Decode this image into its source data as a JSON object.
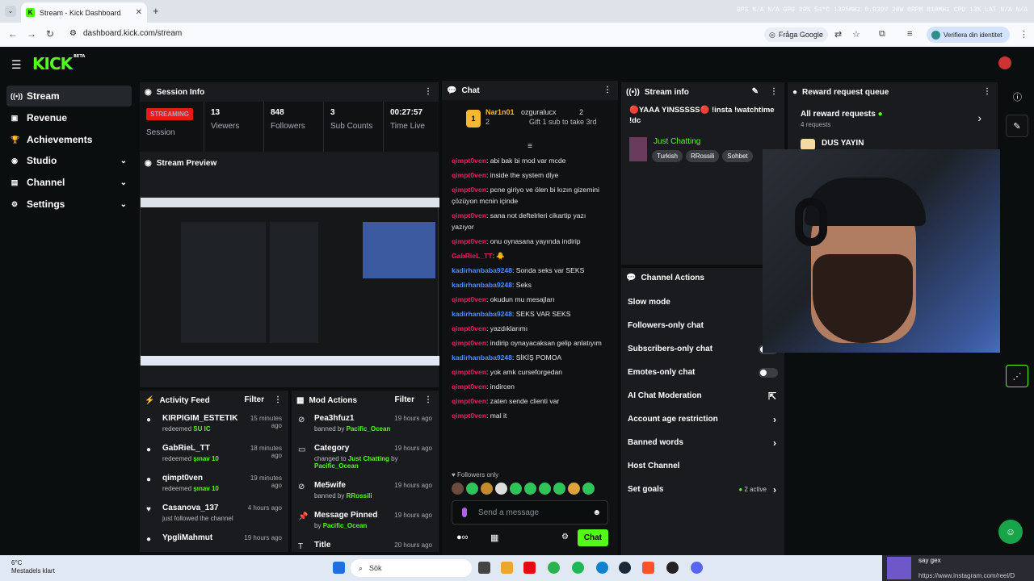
{
  "browser": {
    "tab_title": "Stream - Kick Dashboard",
    "url": "dashboard.kick.com/stream",
    "ask_google": "Fråga Google",
    "verify_identity": "Verifiera din identitet",
    "hud": "BPS N/A N/A   GPU 29% 54°C 1395MHz 0.930V 28W 0RPM 810MHz   CPU 13%   LAT N/A N/A"
  },
  "app": {
    "logo": "KICK",
    "logo_badge": "BETA",
    "accent": "#53fc18"
  },
  "sidebar": {
    "items": [
      {
        "label": "Stream",
        "icon": "broadcast-icon"
      },
      {
        "label": "Revenue",
        "icon": "wallet-icon"
      },
      {
        "label": "Achievements",
        "icon": "trophy-icon"
      },
      {
        "label": "Studio",
        "icon": "studio-icon"
      },
      {
        "label": "Channel",
        "icon": "user-icon"
      },
      {
        "label": "Settings",
        "icon": "gear-icon"
      }
    ]
  },
  "session": {
    "title": "Session Info",
    "status": "STREAMING",
    "session_label": "Session",
    "stats": [
      {
        "value": "13",
        "label": "Viewers"
      },
      {
        "value": "848",
        "label": "Followers"
      },
      {
        "value": "3",
        "label": "Sub Counts"
      },
      {
        "value": "00:27:57",
        "label": "Time Live"
      }
    ]
  },
  "preview": {
    "title": "Stream Preview"
  },
  "activity": {
    "title": "Activity Feed",
    "filter": "Filter",
    "items": [
      {
        "name": "KIRPIGIM_ESTETIK",
        "action": "redeemed",
        "reward": "SU IC",
        "time": "15 minutes ago"
      },
      {
        "name": "GabRieL_TT",
        "action": "redeemed",
        "reward": "şınav 10",
        "time": "18 minutes ago"
      },
      {
        "name": "qimpt0ven",
        "action": "redeemed",
        "reward": "şınav 10",
        "time": "19 minutes ago"
      },
      {
        "name": "Casanova_137",
        "action": "just followed the channel",
        "reward": "",
        "time": "4 hours ago"
      },
      {
        "name": "YpgliMahmut",
        "action": "",
        "reward": "",
        "time": "19 hours ago"
      }
    ]
  },
  "mod": {
    "title": "Mod Actions",
    "filter": "Filter",
    "items": [
      {
        "title": "Pea3hfuz1",
        "sub": "banned by",
        "by": "Pacific_Ocean",
        "time": "19 hours ago",
        "extra": ""
      },
      {
        "title": "Category",
        "sub": "changed to",
        "by": "Just Chatting",
        "time": "19 hours ago",
        "extra": "Pacific_Ocean"
      },
      {
        "title": "Me5wife",
        "sub": "banned by",
        "by": "RRossili",
        "time": "19 hours ago",
        "extra": ""
      },
      {
        "title": "Message Pinned",
        "sub": "by",
        "by": "Pacific_Ocean",
        "time": "19 hours ago",
        "extra": ""
      },
      {
        "title": "Title",
        "sub": "",
        "by": "",
        "time": "20 hours ago",
        "extra": ""
      }
    ]
  },
  "chat": {
    "title": "Chat",
    "leader1_name": "Nar1n01",
    "leader1_count": "2",
    "leader2_name": "ozguralucx",
    "leader2_count": "2",
    "leader2_sub": "Gift 1 sub to take 3rd",
    "messages": [
      {
        "user": "qimpt0ven",
        "color": "red",
        "text": "abi bak bi mod var mcde"
      },
      {
        "user": "qimpt0ven",
        "color": "red",
        "text": "inside the system diye"
      },
      {
        "user": "qimpt0ven",
        "color": "red",
        "text": "pcne giriyo ve ölen bi kızın gizemini çözüyon mcnin içinde"
      },
      {
        "user": "qimpt0ven",
        "color": "red",
        "text": "sana not deftelrleri cikartip yazı yazıyor"
      },
      {
        "user": "qimpt0ven",
        "color": "red",
        "text": "onu oynasana yayında indirip"
      },
      {
        "user": "GabRieL_TT",
        "color": "red",
        "text": "🐥"
      },
      {
        "user": "kadirhanbaba9248",
        "color": "blue",
        "text": "Sonda seks var SEKS"
      },
      {
        "user": "kadirhanbaba9248",
        "color": "blue",
        "text": "Seks"
      },
      {
        "user": "qimpt0ven",
        "color": "red",
        "text": "okudun mu mesajları"
      },
      {
        "user": "kadirhanbaba9248",
        "color": "blue",
        "text": "SEKS VAR SEKS"
      },
      {
        "user": "qimpt0ven",
        "color": "red",
        "text": "yazdıklarımı"
      },
      {
        "user": "qimpt0ven",
        "color": "red",
        "text": "indirip oynayacaksan gelip anlatıyım"
      },
      {
        "user": "kadirhanbaba9248",
        "color": "blue",
        "text": "SİKİŞ POMOA"
      },
      {
        "user": "qimpt0ven",
        "color": "red",
        "text": "yok amk curseforgedan"
      },
      {
        "user": "qimpt0ven",
        "color": "red",
        "text": "indircen"
      },
      {
        "user": "qimpt0ven",
        "color": "red",
        "text": "zaten sende clienti var"
      },
      {
        "user": "qimpt0ven",
        "color": "red",
        "text": "mal it"
      }
    ],
    "followers_only": "Followers only",
    "placeholder": "Send a message",
    "send": "Chat"
  },
  "stream_info": {
    "title": "Stream info",
    "stream_title": "🔴YAAA YINSSSSS🔴 !insta !watchtime !dc",
    "category": "Just Chatting",
    "tags": [
      "Turkish",
      "RRossili",
      "Sohbet"
    ]
  },
  "reward_queue": {
    "title": "Reward request queue",
    "all": "All reward requests",
    "count": "4 requests",
    "first": "DUS YAYIN"
  },
  "channel_actions": {
    "title": "Channel Actions",
    "items": [
      {
        "label": "Slow mode",
        "kind": "none"
      },
      {
        "label": "Followers-only chat",
        "kind": "none"
      },
      {
        "label": "Subscribers-only chat",
        "kind": "toggle"
      },
      {
        "label": "Emotes-only chat",
        "kind": "toggle"
      },
      {
        "label": "AI Chat Moderation",
        "kind": "external"
      },
      {
        "label": "Account age restriction",
        "kind": "arrow"
      },
      {
        "label": "Banned words",
        "kind": "arrow"
      },
      {
        "label": "Host Channel",
        "kind": "none"
      },
      {
        "label": "Set goals",
        "kind": "arrow",
        "extra": "2 active"
      }
    ]
  },
  "taskbar": {
    "temp": "6°C",
    "weather": "Mestadels klart",
    "search": "Sök",
    "notif_title": "say gex",
    "notif_url": "https://www.instagram.com/reel/D"
  }
}
